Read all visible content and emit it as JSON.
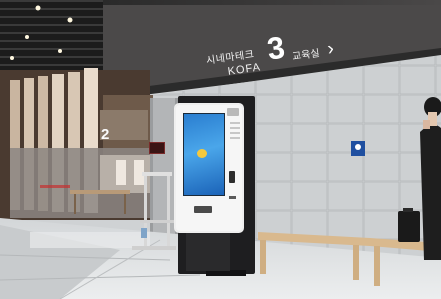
{
  "scene": {
    "description_type": "photo"
  },
  "wall_sign": {
    "line1": "시네마테크",
    "line2": "KOFA",
    "number": "3",
    "room": "교육실",
    "arrow": "›"
  },
  "floor_marker": {
    "number": "2"
  },
  "kiosk": {
    "screen_color": "#3a8fdf",
    "body_color": "#ececec"
  },
  "colors": {
    "ceiling": "#3b3b3b",
    "tile_wall": "#c6c9cb",
    "floor": "#dfe1e2",
    "bench": "#d9b98e",
    "info_sign": "#1f4fa0"
  }
}
